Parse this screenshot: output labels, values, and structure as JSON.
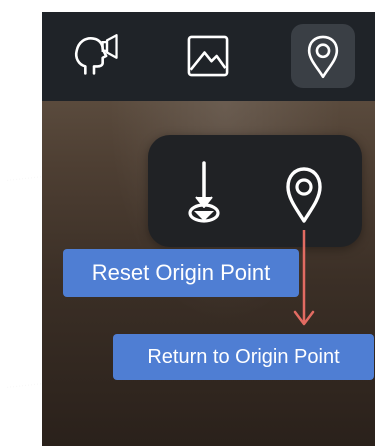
{
  "toolbar": {
    "items": [
      {
        "icon": "voice-announce-icon",
        "active": false
      },
      {
        "icon": "image-icon",
        "active": false
      },
      {
        "icon": "location-pin-icon",
        "active": true
      }
    ]
  },
  "popover": {
    "items": [
      {
        "icon": "reset-origin-icon"
      },
      {
        "icon": "return-origin-icon"
      }
    ]
  },
  "annotations": {
    "reset_label": "Reset Origin Point",
    "return_label": "Return to Origin Point",
    "label_color": "#4f7ed3",
    "arrow_color": "#e26b62"
  }
}
